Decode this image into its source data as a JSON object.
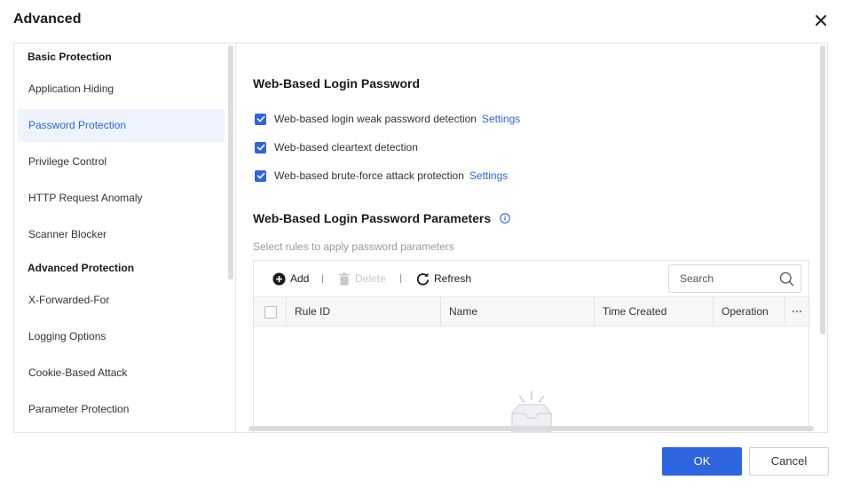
{
  "dialog": {
    "title": "Advanced"
  },
  "sidebar": {
    "groups": [
      "Basic Protection",
      "Advanced Protection"
    ],
    "items": [
      {
        "label": "Application Hiding"
      },
      {
        "label": "Password Protection",
        "active": true
      },
      {
        "label": "Privilege Control"
      },
      {
        "label": "HTTP Request Anomaly"
      },
      {
        "label": "Scanner Blocker"
      },
      {
        "label": "X-Forwarded-For"
      },
      {
        "label": "Logging Options"
      },
      {
        "label": "Cookie-Based Attack"
      },
      {
        "label": "Parameter Protection"
      }
    ]
  },
  "main": {
    "section1_title": "Web-Based Login Password",
    "options": [
      {
        "label": "Web-based login weak password detection",
        "checked": true,
        "link": "Settings"
      },
      {
        "label": "Web-based cleartext detection",
        "checked": true
      },
      {
        "label": "Web-based brute-force attack protection",
        "checked": true,
        "link": "Settings"
      }
    ],
    "section2_title": "Web-Based Login Password Parameters",
    "hint": "Select rules to apply password parameters",
    "toolbar": {
      "add": "Add",
      "delete": "Delete",
      "refresh": "Refresh"
    },
    "search": {
      "placeholder": "Search"
    },
    "table": {
      "columns": [
        "Rule ID",
        "Name",
        "Time Created",
        "Operation"
      ]
    }
  },
  "footer": {
    "ok": "OK",
    "cancel": "Cancel"
  },
  "colors": {
    "accent": "#2f64e0",
    "active_bg": "#eef3fd",
    "border": "#e3e3e3"
  },
  "icons": [
    "close-icon",
    "check-icon",
    "info-icon",
    "add-icon",
    "trash-icon",
    "refresh-icon",
    "search-icon",
    "more-icon",
    "empty-box-icon"
  ]
}
